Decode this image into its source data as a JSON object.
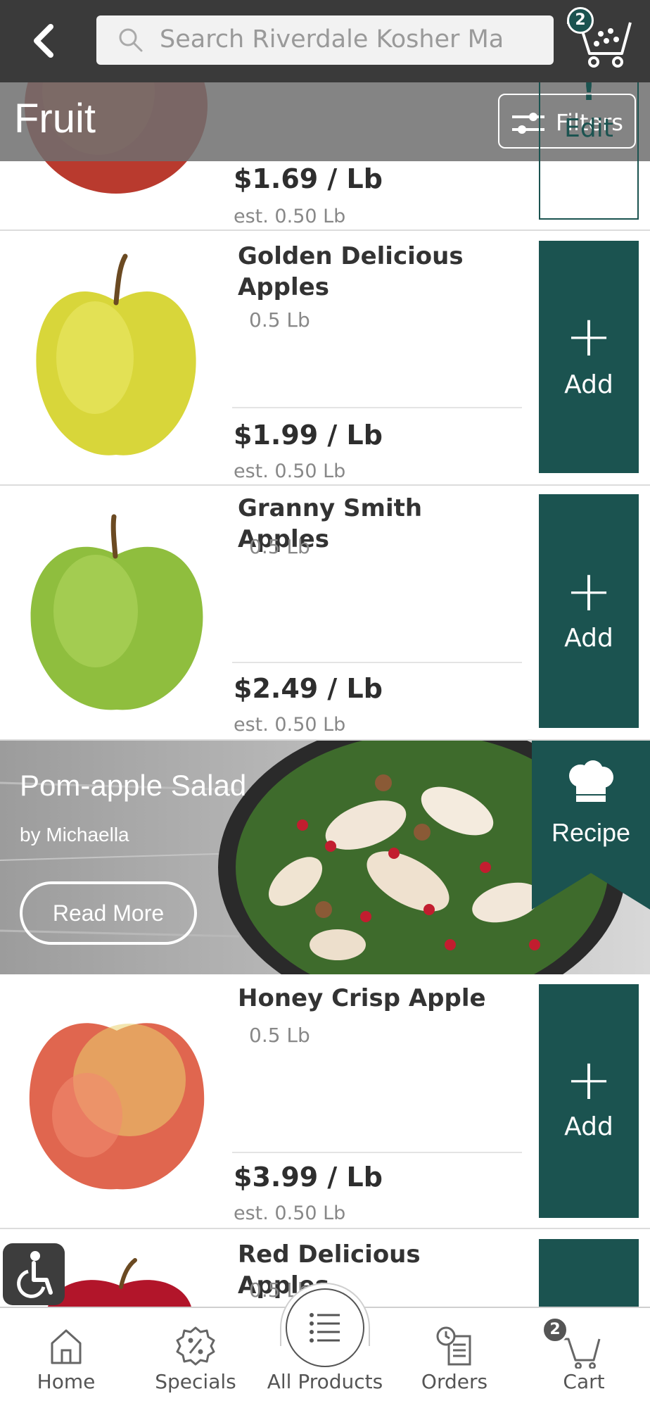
{
  "header": {
    "search_placeholder": "Search Riverdale Kosher Ma",
    "cart_count": "2"
  },
  "category": {
    "title": "Fruit",
    "filters_label": "Filters",
    "edit_label": "Edit"
  },
  "products": [
    {
      "name": "",
      "qty": "",
      "price": "$1.69 / Lb",
      "est": "est. 0.50 Lb"
    },
    {
      "name": "Golden Delicious Apples",
      "qty": "0.5 Lb",
      "price": "$1.99 / Lb",
      "est": "est. 0.50 Lb",
      "add": "Add"
    },
    {
      "name": "Granny Smith Apples",
      "qty": "0.5 Lb",
      "price": "$2.49 / Lb",
      "est": "est. 0.50 Lb",
      "add": "Add"
    },
    {
      "name": "Honey Crisp Apple",
      "qty": "0.5 Lb",
      "price": "$3.99 / Lb",
      "est": "est. 0.50 Lb",
      "add": "Add"
    },
    {
      "name": "Red Delicious Apples",
      "qty": "0.5 Lb"
    }
  ],
  "recipe": {
    "title": "Pom-apple Salad",
    "author": "by Michaella",
    "read_more": "Read More",
    "tag": "Recipe"
  },
  "bottom_nav": {
    "home": "Home",
    "specials": "Specials",
    "all_products": "All Products",
    "orders": "Orders",
    "cart": "Cart",
    "cart_count": "2"
  },
  "colors": {
    "accent": "#1b5350",
    "topbar": "#3a3a3a"
  }
}
